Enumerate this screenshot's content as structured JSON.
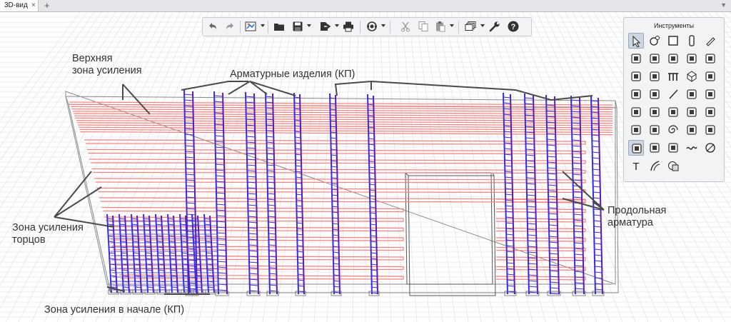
{
  "tab": {
    "label": "3D-вид",
    "close": "×",
    "add": "+"
  },
  "annotations": {
    "top_zone_line1": "Верхняя",
    "top_zone_line2": "зона усиления",
    "products": "Арматурные изделия (КП)",
    "ends_line1": "Зона усиления",
    "ends_line2": "торцов",
    "longitudinal_line1": "Продольная",
    "longitudinal_line2": "арматура",
    "start_zone": "Зона усиления в начале (КП)"
  },
  "toolbar": {
    "buttons": [
      "undo-icon",
      "redo-icon",
      "view-style-icon",
      "open-folder-icon",
      "save-icon",
      "export-icon",
      "print-icon",
      "orbit-icon",
      "cut-icon",
      "copy-icon",
      "paste-icon",
      "layers-icon",
      "wrench-icon",
      "help-icon"
    ]
  },
  "tools_panel": {
    "title": "Инструменты",
    "text_tool": "T",
    "rows": [
      [
        "pointer-tool-icon",
        "node-tool-icon",
        "rectangle-tool-icon",
        "column-tool-icon",
        "pencil-tool-icon"
      ],
      [
        "slab-tool-icon",
        "sloped-slab-tool-icon",
        "stair-tool-icon",
        "wall-tool-icon",
        "roof-tool-icon"
      ],
      [
        "window-tool-icon",
        "door-tool-icon",
        "railing-tool-icon",
        "solid-tool-icon",
        "settings-tool-icon"
      ],
      [
        "anchor-tool-icon",
        "hook-tool-icon",
        "line-tool-icon",
        "opening-tool-icon",
        "embedded-part-tool-icon"
      ],
      [
        "rebar-mesh-tool-icon",
        "rebar-cage-tool-icon",
        "rebar-set-tool-icon",
        "rebar-bent-tool-icon",
        "rebar-loop-tool-icon"
      ],
      [
        "rebar-frame-tool-icon",
        "rebar-pack-tool-icon",
        "spiral-tool-icon",
        "coupler-tool-icon",
        "end-bar-tool-icon"
      ],
      [
        "zone-tool-icon",
        "zone-a-tool-icon",
        "zone-group-tool-icon",
        "wave-tool-icon",
        "diameter-tool-icon"
      ],
      [
        "text-tool-icon",
        "curve-tool-icon",
        "hatch-tool-icon"
      ]
    ]
  },
  "colors": {
    "rebar_long": "#f2837e",
    "rebar_product": "#3a2de0",
    "rebar_product_dark": "#5a1bb0",
    "outline": "#8a8a8a",
    "leader": "#4a4a4a",
    "grid": "#d9dde3"
  }
}
